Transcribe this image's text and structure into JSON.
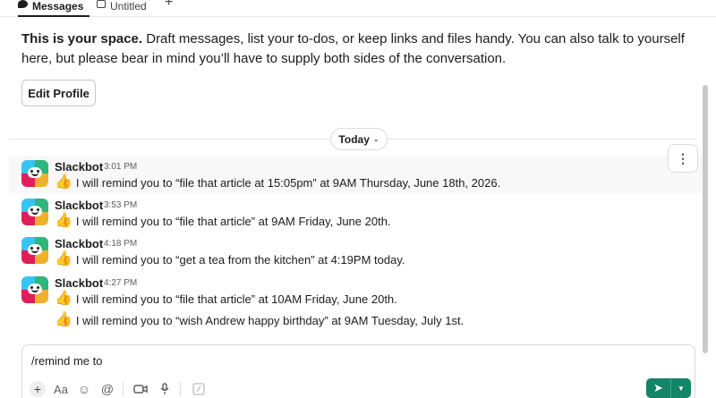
{
  "tabs": [
    {
      "label": "Messages",
      "icon": "message-bubble-icon"
    },
    {
      "label": "Untitled",
      "icon": "canvas-icon"
    }
  ],
  "intro": {
    "bold": "This is your space.",
    "text": " Draft messages, list your to-dos, or keep links and files handy. You can also talk to yourself here, but please bear in mind you’ll have to supply both sides of the conversation."
  },
  "edit_profile_label": "Edit Profile",
  "divider_label": "Today",
  "messages": [
    {
      "sender": "Slackbot",
      "time": "3:01 PM",
      "lines": [
        "I will remind you to “file that article at 15:05pm” at 9AM Thursday, June 18th, 2026."
      ]
    },
    {
      "sender": "Slackbot",
      "time": "3:53 PM",
      "lines": [
        "I will remind you to “file that article” at 9AM Friday, June 20th."
      ]
    },
    {
      "sender": "Slackbot",
      "time": "4:18 PM",
      "lines": [
        "I will remind you to “get a tea from the kitchen” at 4:19PM today."
      ]
    },
    {
      "sender": "Slackbot",
      "time": "4:27 PM",
      "lines": [
        "I will remind you to “file that article” at 10AM Friday, June 20th.",
        "I will remind you to “wish Andrew happy birthday” at 9AM Tuesday, July 1st."
      ]
    }
  ],
  "composer": {
    "value": "/remind me to"
  },
  "colors": {
    "send_button": "#148567",
    "avatar_q1": "#36c5f0",
    "avatar_q2": "#2eb67d",
    "avatar_q3": "#e01e5a",
    "avatar_q4": "#ecb22e"
  }
}
